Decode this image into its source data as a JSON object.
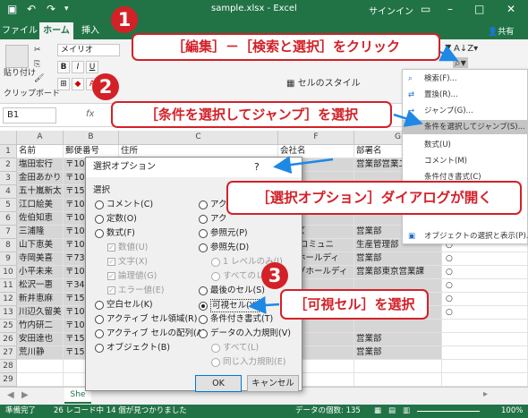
{
  "titlebar": {
    "qat_icons": [
      "save-icon",
      "undo-icon",
      "redo-icon",
      "customize-icon"
    ],
    "filename": "sample.xlsx - Excel",
    "signin": "サインイン"
  },
  "tabs": [
    "ファイル",
    "ホーム",
    "挿入"
  ],
  "share": "共有",
  "ribbon": {
    "paste_label": "貼り付け",
    "clipboard_group": "クリップボード",
    "font_name": "メイリオ",
    "bold": "B",
    "italic": "I",
    "underline": "U",
    "cell_style": "セルのスタイル"
  },
  "namebox": "B1",
  "fx": "fx",
  "columns": [
    "A",
    "B",
    "C",
    "F",
    "G",
    "J"
  ],
  "rows": [
    {
      "n": "1",
      "a": "名前",
      "b": "郵便番号",
      "c": "住所",
      "f": "会社名",
      "g": "部署名"
    },
    {
      "n": "2",
      "a": "塩田宏行",
      "b": "〒107",
      "c": "",
      "f": "",
      "g": "営業部営業二"
    },
    {
      "n": "3",
      "a": "金田あかり",
      "b": "〒107",
      "c": "",
      "f": "",
      "g": ""
    },
    {
      "n": "4",
      "a": "五十嵐新太",
      "b": "〒152",
      "c": "",
      "f": "",
      "g": ""
    },
    {
      "n": "5",
      "a": "江口絵美",
      "b": "〒107",
      "c": "",
      "f": "",
      "g": ""
    },
    {
      "n": "6",
      "a": "佐伯知恵",
      "b": "〒107",
      "c": "",
      "f": "",
      "g": ""
    },
    {
      "n": "7",
      "a": "三浦隆",
      "b": "〒107",
      "c": "",
      "f": "シーズ",
      "g": "営業部"
    },
    {
      "n": "8",
      "a": "山下恵美",
      "b": "〒107",
      "c": "",
      "f": "イブ コミュニ",
      "g": "生産管理部"
    },
    {
      "n": "9",
      "a": "寺岡美喜",
      "b": "〒733",
      "c": "",
      "f": "ストホールディ",
      "g": "営業部"
    },
    {
      "n": "10",
      "a": "小平未来",
      "b": "〒107",
      "c": "",
      "f": "シングホールディ",
      "g": "営業部東京営業課"
    },
    {
      "n": "11",
      "a": "松沢一惠",
      "b": "〒347",
      "c": "",
      "f": "",
      "g": ""
    },
    {
      "n": "12",
      "a": "新井恵麻",
      "b": "〒152",
      "c": "",
      "f": "",
      "g": ""
    },
    {
      "n": "13",
      "a": "川辺久留美",
      "b": "〒107",
      "c": "",
      "f": "",
      "g": ""
    },
    {
      "n": "25",
      "a": "竹内研二",
      "b": "〒107",
      "c": "",
      "f": "",
      "g": ""
    },
    {
      "n": "26",
      "a": "安田達也",
      "b": "〒152",
      "c": "",
      "f": "KDE",
      "g": "営業部"
    },
    {
      "n": "27",
      "a": "荒川静",
      "b": "〒152",
      "c": "",
      "f": "",
      "g": "営業部"
    },
    {
      "n": "28",
      "a": "",
      "b": "",
      "c": "",
      "f": "",
      "g": ""
    },
    {
      "n": "29",
      "a": "",
      "b": "",
      "c": "",
      "f": "",
      "g": ""
    },
    {
      "n": "30",
      "a": "",
      "b": "",
      "c": "",
      "f": "",
      "g": ""
    }
  ],
  "circle_marks": [
    "○",
    "○",
    "○",
    "○",
    "○",
    "○",
    "○"
  ],
  "sheet_tab": "She",
  "status": {
    "ready": "準備完了",
    "found": "26 レコード中 14 個が見つかりました",
    "count": "データの個数: 135",
    "zoom": "100%"
  },
  "menu": [
    {
      "label": "検索(F)...",
      "icon": "search-icon"
    },
    {
      "label": "置換(R)...",
      "icon": "replace-icon"
    },
    {
      "label": "ジャンプ(G)...",
      "icon": "goto-arrow-icon"
    },
    {
      "label": "条件を選択してジャンプ(S)...",
      "icon": ""
    },
    {
      "label": "数式(U)",
      "icon": ""
    },
    {
      "label": "コメント(M)",
      "icon": ""
    },
    {
      "label": "条件付き書式(C)",
      "icon": ""
    },
    {
      "label": "オブジェクトの選択と表示(P)...",
      "icon": "objects-icon"
    }
  ],
  "dialog": {
    "title": "選択オプション",
    "help": "?",
    "group": "選択",
    "left": [
      {
        "label": "コメント(C)",
        "type": "radio"
      },
      {
        "label": "定数(O)",
        "type": "radio"
      },
      {
        "label": "数式(F)",
        "type": "radio"
      },
      {
        "label": "数値(U)",
        "type": "check"
      },
      {
        "label": "文字(X)",
        "type": "check"
      },
      {
        "label": "論理値(G)",
        "type": "check"
      },
      {
        "label": "エラー値(E)",
        "type": "check"
      },
      {
        "label": "空白セル(K)",
        "type": "radio"
      },
      {
        "label": "アクティブ セル領域(R)",
        "type": "radio"
      },
      {
        "label": "アクティブ セルの配列(A)",
        "type": "radio"
      },
      {
        "label": "オブジェクト(B)",
        "type": "radio"
      }
    ],
    "right": [
      {
        "label": "アク",
        "type": "radio"
      },
      {
        "label": "アク",
        "type": "radio"
      },
      {
        "label": "参照元(P)",
        "type": "radio"
      },
      {
        "label": "参照先(D)",
        "type": "radio"
      },
      {
        "label": "1 レベルのみ(I)",
        "type": "radio-dis"
      },
      {
        "label": "すべてのレベル",
        "type": "radio-dis"
      },
      {
        "label": "最後のセル(S)",
        "type": "radio"
      },
      {
        "label": "可視セル(Y)",
        "type": "radio-on"
      },
      {
        "label": "条件付き書式(T)",
        "type": "radio"
      },
      {
        "label": "データの入力規則(V)",
        "type": "radio"
      },
      {
        "label": "すべて(L)",
        "type": "radio-dis"
      },
      {
        "label": "同じ入力規則(E)",
        "type": "radio-dis"
      }
    ],
    "ok": "OK",
    "cancel": "キャンセル"
  },
  "callouts": [
    {
      "num": "1",
      "text": "［編集］－［検索と選択］をクリック"
    },
    {
      "num": "2",
      "text": "［条件を選択してジャンプ］を選択"
    },
    {
      "num": "",
      "text": "［選択オプション］ダイアログが開く"
    },
    {
      "num": "3",
      "text": "［可視セル］を選択"
    }
  ],
  "colors": {
    "excel_green": "#217346",
    "callout_red": "#d32128",
    "arrow_blue": "#1e88e5"
  }
}
